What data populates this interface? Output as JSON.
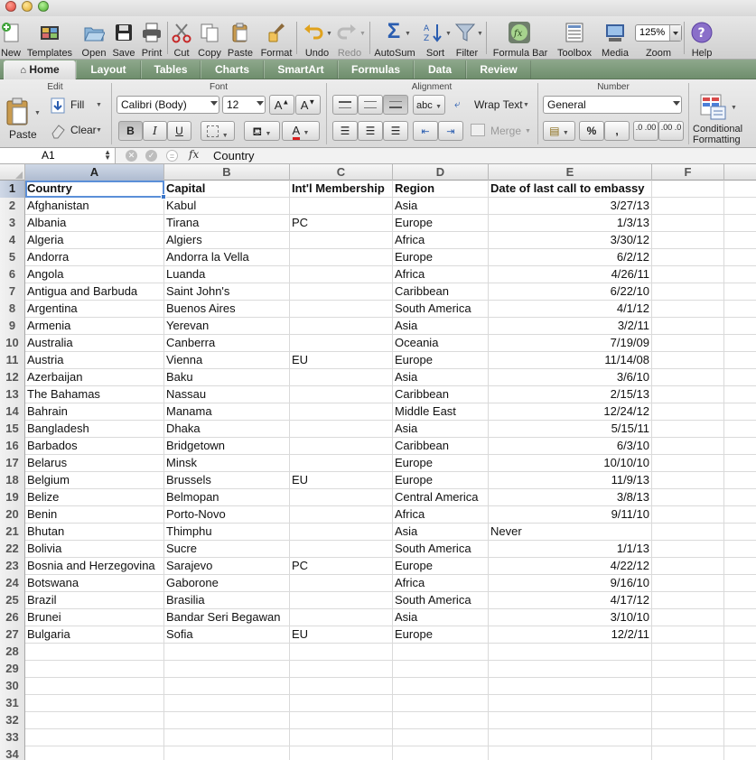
{
  "toolbar": {
    "buttons": [
      {
        "id": "new",
        "label": "New",
        "icon": "new-icon"
      },
      {
        "id": "templates",
        "label": "Templates",
        "icon": "templates-icon"
      },
      {
        "id": "open",
        "label": "Open",
        "icon": "open-icon"
      },
      {
        "id": "save",
        "label": "Save",
        "icon": "save-icon"
      },
      {
        "id": "print",
        "label": "Print",
        "icon": "print-icon"
      },
      {
        "id": "cut",
        "label": "Cut",
        "icon": "cut-icon"
      },
      {
        "id": "copy",
        "label": "Copy",
        "icon": "copy-icon"
      },
      {
        "id": "paste",
        "label": "Paste",
        "icon": "paste-icon"
      },
      {
        "id": "format",
        "label": "Format",
        "icon": "format-painter-icon"
      },
      {
        "id": "undo",
        "label": "Undo",
        "icon": "undo-icon"
      },
      {
        "id": "redo",
        "label": "Redo",
        "icon": "redo-icon",
        "disabled": true
      },
      {
        "id": "autosum",
        "label": "AutoSum",
        "icon": "autosum-icon"
      },
      {
        "id": "sort",
        "label": "Sort",
        "icon": "sort-icon"
      },
      {
        "id": "filter",
        "label": "Filter",
        "icon": "filter-icon"
      },
      {
        "id": "formula_bar",
        "label": "Formula Bar",
        "icon": "formula-bar-icon"
      },
      {
        "id": "toolbox",
        "label": "Toolbox",
        "icon": "toolbox-icon"
      },
      {
        "id": "media",
        "label": "Media",
        "icon": "media-icon"
      },
      {
        "id": "zoom",
        "label": "Zoom",
        "icon": "zoom-icon"
      },
      {
        "id": "help",
        "label": "Help",
        "icon": "help-icon"
      }
    ],
    "zoom_value": "125%"
  },
  "ribbon_tabs": [
    "Home",
    "Layout",
    "Tables",
    "Charts",
    "SmartArt",
    "Formulas",
    "Data",
    "Review"
  ],
  "ribbon": {
    "groups": {
      "edit": "Edit",
      "font": "Font",
      "alignment": "Alignment",
      "number": "Number"
    },
    "paste": "Paste",
    "fill": "Fill",
    "clear": "Clear",
    "font_name": "Calibri (Body)",
    "font_size": "12",
    "bold": "B",
    "italic": "I",
    "underline": "U",
    "wrap_text": "Wrap Text",
    "merge": "Merge",
    "abc": "abc",
    "number_format": "General",
    "percent": "%",
    "comma": ",",
    "inc_decimal": ".0 .00",
    "dec_decimal": ".00 .0",
    "conditional_formatting": [
      "Conditional",
      "Formatting"
    ]
  },
  "formula_bar": {
    "name_box": "A1",
    "fx": "fx",
    "content": "Country"
  },
  "columns": [
    "A",
    "B",
    "C",
    "D",
    "E",
    "F"
  ],
  "sheet": {
    "headers": [
      "Country",
      "Capital",
      "Int'l Membership",
      "Region",
      "Date of last call to embassy"
    ],
    "rows": [
      [
        "Afghanistan",
        "Kabul",
        "",
        "Asia",
        "3/27/13"
      ],
      [
        "Albania",
        "Tirana",
        "PC",
        "Europe",
        "1/3/13"
      ],
      [
        "Algeria",
        "Algiers",
        "",
        "Africa",
        "3/30/12"
      ],
      [
        "Andorra",
        "Andorra la Vella",
        "",
        "Europe",
        "6/2/12"
      ],
      [
        "Angola",
        "Luanda",
        "",
        "Africa",
        "4/26/11"
      ],
      [
        "Antigua and Barbuda",
        "Saint John's",
        "",
        "Caribbean",
        "6/22/10"
      ],
      [
        "Argentina",
        "Buenos Aires",
        "",
        "South America",
        "4/1/12"
      ],
      [
        "Armenia",
        "Yerevan",
        "",
        "Asia",
        "3/2/11"
      ],
      [
        "Australia",
        "Canberra",
        "",
        "Oceania",
        "7/19/09"
      ],
      [
        "Austria",
        "Vienna",
        "EU",
        "Europe",
        "11/14/08"
      ],
      [
        "Azerbaijan",
        "Baku",
        "",
        "Asia",
        "3/6/10"
      ],
      [
        "The Bahamas",
        "Nassau",
        "",
        "Caribbean",
        "2/15/13"
      ],
      [
        "Bahrain",
        "Manama",
        "",
        "Middle East",
        "12/24/12"
      ],
      [
        "Bangladesh",
        "Dhaka",
        "",
        "Asia",
        "5/15/11"
      ],
      [
        "Barbados",
        "Bridgetown",
        "",
        "Caribbean",
        "6/3/10"
      ],
      [
        "Belarus",
        "Minsk",
        "",
        "Europe",
        "10/10/10"
      ],
      [
        "Belgium",
        "Brussels",
        "EU",
        "Europe",
        "11/9/13"
      ],
      [
        "Belize",
        "Belmopan",
        "",
        "Central America",
        "3/8/13"
      ],
      [
        "Benin",
        "Porto-Novo",
        "",
        "Africa",
        "9/11/10"
      ],
      [
        "Bhutan",
        "Thimphu",
        "",
        "Asia",
        "Never"
      ],
      [
        "Bolivia",
        "Sucre",
        "",
        "South America",
        "1/1/13"
      ],
      [
        "Bosnia and Herzegovina",
        "Sarajevo",
        "PC",
        "Europe",
        "4/22/12"
      ],
      [
        "Botswana",
        "Gaborone",
        "",
        "Africa",
        "9/16/10"
      ],
      [
        "Brazil",
        "Brasilia",
        "",
        "South America",
        "4/17/12"
      ],
      [
        "Brunei",
        "Bandar Seri Begawan",
        "",
        "Asia",
        "3/10/10"
      ],
      [
        "Bulgaria",
        "Sofia",
        "EU",
        "Europe",
        "12/2/11"
      ]
    ],
    "total_rows_visible": 34
  },
  "colors": {
    "ribbon_tab_bar": "#7f9c7d",
    "selection": "#5b8fd8"
  }
}
